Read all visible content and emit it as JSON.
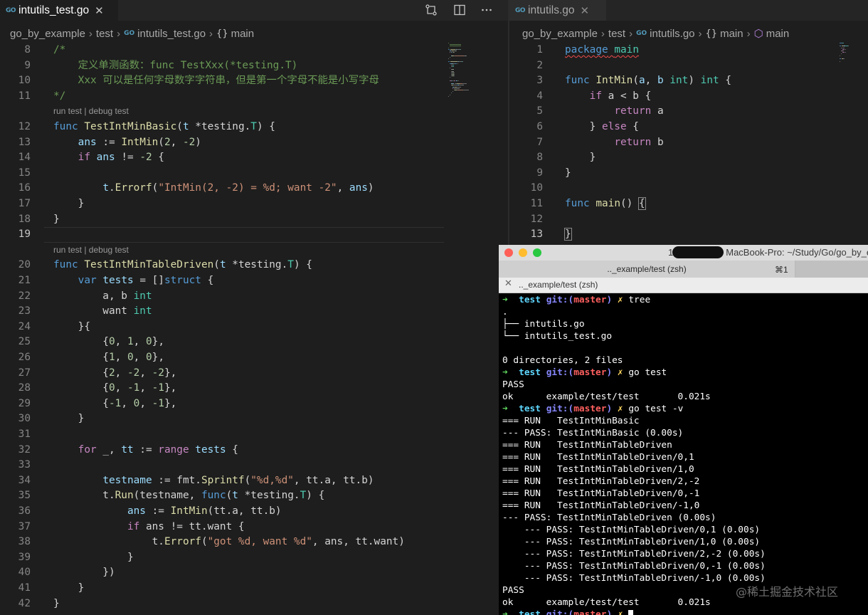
{
  "left_editor": {
    "tab": {
      "icon": "go-file-icon",
      "title": "intutils_test.go",
      "close": "✕"
    },
    "toolbar": [
      "compare-changes-icon",
      "split-editor-icon",
      "more-actions-icon"
    ],
    "breadcrumb": {
      "folder1": "go_by_example",
      "folder2": "test",
      "file": "intutils_test.go",
      "symbol": "main"
    },
    "code_lens": "run test | debug test",
    "current_line": "19",
    "lines": [
      {
        "n": "8",
        "tokens": [
          [
            "t-com",
            "/*"
          ]
        ]
      },
      {
        "n": "9",
        "tokens": [
          [
            "t-com",
            "    定义单测函数：func TestXxx(*testing.T)"
          ]
        ]
      },
      {
        "n": "10",
        "tokens": [
          [
            "t-com",
            "    Xxx 可以是任何字母数字字符串，但是第一个字母不能是小写字母"
          ]
        ]
      },
      {
        "n": "11",
        "tokens": [
          [
            "t-com",
            "*/"
          ]
        ]
      },
      {
        "n": "12",
        "tokens": [
          [
            "t-kw",
            "func"
          ],
          [
            "t-pl",
            " "
          ],
          [
            "t-fn",
            "TestIntMinBasic"
          ],
          [
            "t-pl",
            "("
          ],
          [
            "t-var",
            "t"
          ],
          [
            "t-pl",
            " *testing."
          ],
          [
            "t-type",
            "T"
          ],
          [
            "t-pl",
            ") {"
          ]
        ]
      },
      {
        "n": "13",
        "tokens": [
          [
            "t-pl",
            "    "
          ],
          [
            "t-var",
            "ans"
          ],
          [
            "t-pl",
            " := "
          ],
          [
            "t-fn",
            "IntMin"
          ],
          [
            "t-pl",
            "("
          ],
          [
            "t-num",
            "2"
          ],
          [
            "t-pl",
            ", "
          ],
          [
            "t-num",
            "-2"
          ],
          [
            "t-pl",
            ")"
          ]
        ]
      },
      {
        "n": "14",
        "tokens": [
          [
            "t-pl",
            "    "
          ],
          [
            "t-ctl",
            "if"
          ],
          [
            "t-pl",
            " "
          ],
          [
            "t-var",
            "ans"
          ],
          [
            "t-pl",
            " != "
          ],
          [
            "t-num",
            "-2"
          ],
          [
            "t-pl",
            " {"
          ]
        ]
      },
      {
        "n": "15",
        "tokens": []
      },
      {
        "n": "16",
        "tokens": [
          [
            "t-pl",
            "        "
          ],
          [
            "t-var",
            "t"
          ],
          [
            "t-pl",
            "."
          ],
          [
            "t-fn",
            "Errorf"
          ],
          [
            "t-pl",
            "("
          ],
          [
            "t-str",
            "\"IntMin(2, -2) = %d; want -2\""
          ],
          [
            "t-pl",
            ", "
          ],
          [
            "t-var",
            "ans"
          ],
          [
            "t-pl",
            ")"
          ]
        ]
      },
      {
        "n": "17",
        "tokens": [
          [
            "t-pl",
            "    }"
          ]
        ]
      },
      {
        "n": "18",
        "tokens": [
          [
            "t-pl",
            "}"
          ]
        ]
      },
      {
        "n": "19",
        "tokens": []
      },
      {
        "n": "20",
        "tokens": [
          [
            "t-kw",
            "func"
          ],
          [
            "t-pl",
            " "
          ],
          [
            "t-fn",
            "TestIntMinTableDriven"
          ],
          [
            "t-pl",
            "("
          ],
          [
            "t-var",
            "t"
          ],
          [
            "t-pl",
            " *testing."
          ],
          [
            "t-type",
            "T"
          ],
          [
            "t-pl",
            ") {"
          ]
        ]
      },
      {
        "n": "21",
        "tokens": [
          [
            "t-pl",
            "    "
          ],
          [
            "t-kw",
            "var"
          ],
          [
            "t-pl",
            " "
          ],
          [
            "t-var",
            "tests"
          ],
          [
            "t-pl",
            " = []"
          ],
          [
            "t-kw",
            "struct"
          ],
          [
            "t-pl",
            " {"
          ]
        ]
      },
      {
        "n": "22",
        "tokens": [
          [
            "t-pl",
            "        a, b "
          ],
          [
            "t-type",
            "int"
          ]
        ]
      },
      {
        "n": "23",
        "tokens": [
          [
            "t-pl",
            "        want "
          ],
          [
            "t-type",
            "int"
          ]
        ]
      },
      {
        "n": "24",
        "tokens": [
          [
            "t-pl",
            "    }{"
          ]
        ]
      },
      {
        "n": "25",
        "tokens": [
          [
            "t-pl",
            "        {"
          ],
          [
            "t-num",
            "0"
          ],
          [
            "t-pl",
            ", "
          ],
          [
            "t-num",
            "1"
          ],
          [
            "t-pl",
            ", "
          ],
          [
            "t-num",
            "0"
          ],
          [
            "t-pl",
            "},"
          ]
        ]
      },
      {
        "n": "26",
        "tokens": [
          [
            "t-pl",
            "        {"
          ],
          [
            "t-num",
            "1"
          ],
          [
            "t-pl",
            ", "
          ],
          [
            "t-num",
            "0"
          ],
          [
            "t-pl",
            ", "
          ],
          [
            "t-num",
            "0"
          ],
          [
            "t-pl",
            "},"
          ]
        ]
      },
      {
        "n": "27",
        "tokens": [
          [
            "t-pl",
            "        {"
          ],
          [
            "t-num",
            "2"
          ],
          [
            "t-pl",
            ", "
          ],
          [
            "t-num",
            "-2"
          ],
          [
            "t-pl",
            ", "
          ],
          [
            "t-num",
            "-2"
          ],
          [
            "t-pl",
            "},"
          ]
        ]
      },
      {
        "n": "28",
        "tokens": [
          [
            "t-pl",
            "        {"
          ],
          [
            "t-num",
            "0"
          ],
          [
            "t-pl",
            ", "
          ],
          [
            "t-num",
            "-1"
          ],
          [
            "t-pl",
            ", "
          ],
          [
            "t-num",
            "-1"
          ],
          [
            "t-pl",
            "},"
          ]
        ]
      },
      {
        "n": "29",
        "tokens": [
          [
            "t-pl",
            "        {"
          ],
          [
            "t-num",
            "-1"
          ],
          [
            "t-pl",
            ", "
          ],
          [
            "t-num",
            "0"
          ],
          [
            "t-pl",
            ", "
          ],
          [
            "t-num",
            "-1"
          ],
          [
            "t-pl",
            "},"
          ]
        ]
      },
      {
        "n": "30",
        "tokens": [
          [
            "t-pl",
            "    }"
          ]
        ]
      },
      {
        "n": "31",
        "tokens": []
      },
      {
        "n": "32",
        "tokens": [
          [
            "t-pl",
            "    "
          ],
          [
            "t-ctl",
            "for"
          ],
          [
            "t-pl",
            " _, "
          ],
          [
            "t-var",
            "tt"
          ],
          [
            "t-pl",
            " := "
          ],
          [
            "t-ctl",
            "range"
          ],
          [
            "t-pl",
            " "
          ],
          [
            "t-var",
            "tests"
          ],
          [
            "t-pl",
            " {"
          ]
        ]
      },
      {
        "n": "33",
        "tokens": []
      },
      {
        "n": "34",
        "tokens": [
          [
            "t-pl",
            "        "
          ],
          [
            "t-var",
            "testname"
          ],
          [
            "t-pl",
            " := fmt."
          ],
          [
            "t-fn",
            "Sprintf"
          ],
          [
            "t-pl",
            "("
          ],
          [
            "t-str",
            "\"%d,%d\""
          ],
          [
            "t-pl",
            ", tt.a, tt.b)"
          ]
        ]
      },
      {
        "n": "35",
        "tokens": [
          [
            "t-pl",
            "        t."
          ],
          [
            "t-fn",
            "Run"
          ],
          [
            "t-pl",
            "(testname, "
          ],
          [
            "t-kw",
            "func"
          ],
          [
            "t-pl",
            "("
          ],
          [
            "t-var",
            "t"
          ],
          [
            "t-pl",
            " *testing."
          ],
          [
            "t-type",
            "T"
          ],
          [
            "t-pl",
            ") {"
          ]
        ]
      },
      {
        "n": "36",
        "tokens": [
          [
            "t-pl",
            "            "
          ],
          [
            "t-var",
            "ans"
          ],
          [
            "t-pl",
            " := "
          ],
          [
            "t-fn",
            "IntMin"
          ],
          [
            "t-pl",
            "(tt.a, tt.b)"
          ]
        ]
      },
      {
        "n": "37",
        "tokens": [
          [
            "t-pl",
            "            "
          ],
          [
            "t-ctl",
            "if"
          ],
          [
            "t-pl",
            " ans != tt.want {"
          ]
        ]
      },
      {
        "n": "38",
        "tokens": [
          [
            "t-pl",
            "                t."
          ],
          [
            "t-fn",
            "Errorf"
          ],
          [
            "t-pl",
            "("
          ],
          [
            "t-str",
            "\"got %d, want %d\""
          ],
          [
            "t-pl",
            ", ans, tt.want)"
          ]
        ]
      },
      {
        "n": "39",
        "tokens": [
          [
            "t-pl",
            "            }"
          ]
        ]
      },
      {
        "n": "40",
        "tokens": [
          [
            "t-pl",
            "        })"
          ]
        ]
      },
      {
        "n": "41",
        "tokens": [
          [
            "t-pl",
            "    }"
          ]
        ]
      },
      {
        "n": "42",
        "tokens": [
          [
            "t-pl",
            "}"
          ]
        ]
      }
    ]
  },
  "right_editor": {
    "tab": {
      "icon": "go-file-icon",
      "title": "intutils.go",
      "close": "✕"
    },
    "breadcrumb": {
      "folder1": "go_by_example",
      "folder2": "test",
      "file": "intutils.go",
      "symbol1": "main",
      "symbol2": "main"
    },
    "current_line": "13",
    "lines": [
      {
        "n": "1",
        "tokens": [
          [
            "t-kw squiggle",
            "package"
          ],
          [
            "t-pl squiggle",
            " "
          ],
          [
            "t-type squiggle",
            "main"
          ]
        ]
      },
      {
        "n": "2",
        "tokens": []
      },
      {
        "n": "3",
        "tokens": [
          [
            "t-kw",
            "func"
          ],
          [
            "t-pl",
            " "
          ],
          [
            "t-fn",
            "IntMin"
          ],
          [
            "t-pl",
            "("
          ],
          [
            "t-var",
            "a"
          ],
          [
            "t-pl",
            ", "
          ],
          [
            "t-var",
            "b"
          ],
          [
            "t-pl",
            " "
          ],
          [
            "t-type",
            "int"
          ],
          [
            "t-pl",
            ") "
          ],
          [
            "t-type",
            "int"
          ],
          [
            "t-pl",
            " {"
          ]
        ]
      },
      {
        "n": "4",
        "tokens": [
          [
            "t-pl",
            "    "
          ],
          [
            "t-ctl",
            "if"
          ],
          [
            "t-pl",
            " a < b {"
          ]
        ]
      },
      {
        "n": "5",
        "tokens": [
          [
            "t-pl",
            "        "
          ],
          [
            "t-ctl",
            "return"
          ],
          [
            "t-pl",
            " a"
          ]
        ]
      },
      {
        "n": "6",
        "tokens": [
          [
            "t-pl",
            "    } "
          ],
          [
            "t-ctl",
            "else"
          ],
          [
            "t-pl",
            " {"
          ]
        ]
      },
      {
        "n": "7",
        "tokens": [
          [
            "t-pl",
            "        "
          ],
          [
            "t-ctl",
            "return"
          ],
          [
            "t-pl",
            " b"
          ]
        ]
      },
      {
        "n": "8",
        "tokens": [
          [
            "t-pl",
            "    }"
          ]
        ]
      },
      {
        "n": "9",
        "tokens": [
          [
            "t-pl",
            "}"
          ]
        ]
      },
      {
        "n": "10",
        "tokens": []
      },
      {
        "n": "11",
        "tokens": [
          [
            "t-kw",
            "func"
          ],
          [
            "t-pl",
            " "
          ],
          [
            "t-fn",
            "main"
          ],
          [
            "t-pl",
            "() "
          ],
          [
            "t-pl bracket-hl",
            "{"
          ]
        ]
      },
      {
        "n": "12",
        "tokens": []
      },
      {
        "n": "13",
        "tokens": [
          [
            "t-pl bracket-hl",
            "}"
          ]
        ]
      }
    ]
  },
  "terminal": {
    "title_prefix": "1",
    "title": "MacBook-Pro: ~/Study/Go/go_by_e",
    "tab_label": ".._example/test (zsh)",
    "tab_shortcut": "⌘1",
    "subbar_close": "✕",
    "subbar_label": ".._example/test (zsh)",
    "lines": [
      {
        "type": "prompt",
        "dir": "test",
        "git": "git:(",
        "branch": "master",
        "git_close": ")",
        "x": "✗",
        "cmd": "tree"
      },
      {
        "type": "out",
        "text": "."
      },
      {
        "type": "out",
        "text": "├── intutils.go"
      },
      {
        "type": "out",
        "text": "└── intutils_test.go"
      },
      {
        "type": "out",
        "text": ""
      },
      {
        "type": "out",
        "text": "0 directories, 2 files"
      },
      {
        "type": "prompt",
        "dir": "test",
        "git": "git:(",
        "branch": "master",
        "git_close": ")",
        "x": "✗",
        "cmd": "go test"
      },
      {
        "type": "out",
        "text": "PASS"
      },
      {
        "type": "out",
        "text": "ok      example/test/test       0.021s"
      },
      {
        "type": "prompt",
        "dir": "test",
        "git": "git:(",
        "branch": "master",
        "git_close": ")",
        "x": "✗",
        "cmd": "go test -v"
      },
      {
        "type": "out",
        "text": "=== RUN   TestIntMinBasic"
      },
      {
        "type": "out",
        "text": "--- PASS: TestIntMinBasic (0.00s)"
      },
      {
        "type": "out",
        "text": "=== RUN   TestIntMinTableDriven"
      },
      {
        "type": "out",
        "text": "=== RUN   TestIntMinTableDriven/0,1"
      },
      {
        "type": "out",
        "text": "=== RUN   TestIntMinTableDriven/1,0"
      },
      {
        "type": "out",
        "text": "=== RUN   TestIntMinTableDriven/2,-2"
      },
      {
        "type": "out",
        "text": "=== RUN   TestIntMinTableDriven/0,-1"
      },
      {
        "type": "out",
        "text": "=== RUN   TestIntMinTableDriven/-1,0"
      },
      {
        "type": "out",
        "text": "--- PASS: TestIntMinTableDriven (0.00s)"
      },
      {
        "type": "out",
        "text": "    --- PASS: TestIntMinTableDriven/0,1 (0.00s)"
      },
      {
        "type": "out",
        "text": "    --- PASS: TestIntMinTableDriven/1,0 (0.00s)"
      },
      {
        "type": "out",
        "text": "    --- PASS: TestIntMinTableDriven/2,-2 (0.00s)"
      },
      {
        "type": "out",
        "text": "    --- PASS: TestIntMinTableDriven/0,-1 (0.00s)"
      },
      {
        "type": "out",
        "text": "    --- PASS: TestIntMinTableDriven/-1,0 (0.00s)"
      },
      {
        "type": "out",
        "text": "PASS"
      },
      {
        "type": "out",
        "text": "ok      example/test/test       0.021s"
      },
      {
        "type": "prompt",
        "dir": "test",
        "git": "git:(",
        "branch": "master",
        "git_close": ")",
        "x": "✗",
        "cmd": "",
        "cursor": true
      }
    ]
  },
  "watermark": "@稀土掘金技术社区",
  "icons": {
    "go_badge": "GO",
    "folder_sep": "›",
    "symbol_braces": "{}",
    "symbol_package": "⬡"
  }
}
